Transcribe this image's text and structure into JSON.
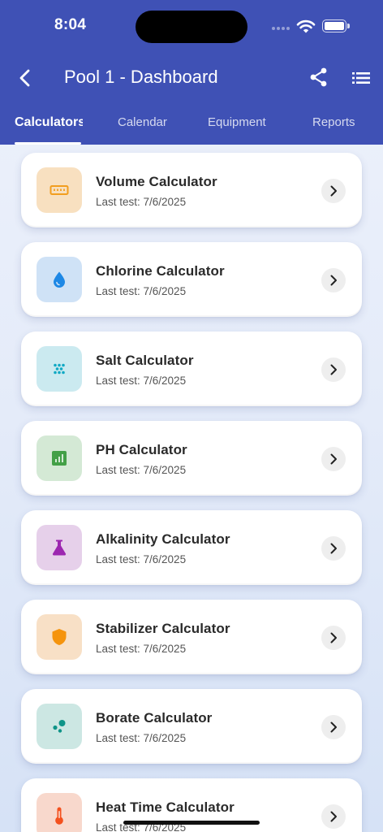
{
  "status_bar": {
    "time": "8:04"
  },
  "header": {
    "title": "Pool 1 - Dashboard",
    "tabs": [
      {
        "label": "Calculators",
        "active": true
      },
      {
        "label": "Calendar",
        "active": false
      },
      {
        "label": "Equipment",
        "active": false
      },
      {
        "label": "Reports",
        "active": false
      }
    ]
  },
  "colors": {
    "header_bg": "#3f51b5"
  },
  "calculators": [
    {
      "title": "Volume Calculator",
      "subtitle": "Last test: 7/6/2025",
      "icon": "ruler-icon",
      "icon_color": "#f29e1f",
      "icon_bg": "#f8e0c0"
    },
    {
      "title": "Chlorine Calculator",
      "subtitle": "Last test: 7/6/2025",
      "icon": "water-drop-icon",
      "icon_color": "#1e88e5",
      "icon_bg": "#cfe2f6"
    },
    {
      "title": "Salt Calculator",
      "subtitle": "Last test: 7/6/2025",
      "icon": "grain-icon",
      "icon_color": "#11a9c4",
      "icon_bg": "#cbeaf0"
    },
    {
      "title": "PH Calculator",
      "subtitle": "Last test: 7/6/2025",
      "icon": "chart-icon",
      "icon_color": "#43a047",
      "icon_bg": "#d4e9d5"
    },
    {
      "title": "Alkalinity Calculator",
      "subtitle": "Last test: 7/6/2025",
      "icon": "flask-icon",
      "icon_color": "#9c27b0",
      "icon_bg": "#e6d0ea"
    },
    {
      "title": "Stabilizer Calculator",
      "subtitle": "Last test: 7/6/2025",
      "icon": "shield-icon",
      "icon_color": "#f5940d",
      "icon_bg": "#f8e0c6"
    },
    {
      "title": "Borate Calculator",
      "subtitle": "Last test: 7/6/2025",
      "icon": "bubbles-icon",
      "icon_color": "#0f9488",
      "icon_bg": "#cce7e3"
    },
    {
      "title": "Heat Time Calculator",
      "subtitle": "Last test: 7/6/2025",
      "icon": "thermometer-icon",
      "icon_color": "#f4511e",
      "icon_bg": "#f8d8cc"
    }
  ]
}
